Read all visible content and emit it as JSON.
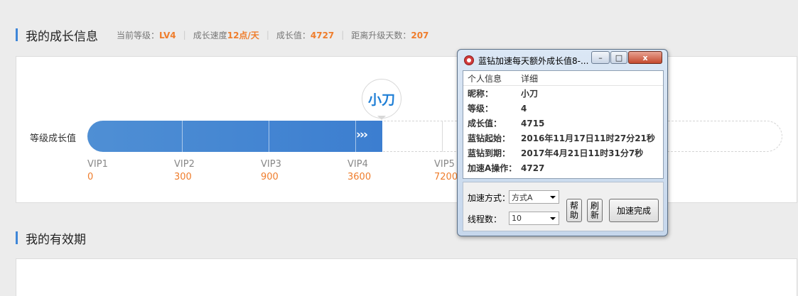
{
  "growth": {
    "title": "我的成长信息",
    "stats": [
      {
        "label": "当前等级：",
        "value": "LV4"
      },
      {
        "label": "成长速度",
        "value": "12点/天"
      },
      {
        "label": "成长值：",
        "value": "4727"
      },
      {
        "label": "距离升级天数：",
        "value": "207"
      }
    ],
    "track_label": "等级成长值",
    "avatar_text": "小刀",
    "progress_arrows": "›››",
    "levels": [
      {
        "name": "VIP1",
        "points": "0"
      },
      {
        "name": "VIP2",
        "points": "300"
      },
      {
        "name": "VIP3",
        "points": "900"
      },
      {
        "name": "VIP4",
        "points": "3600"
      },
      {
        "name": "VIP5",
        "points": "7200"
      }
    ]
  },
  "validity": {
    "title": "我的有效期"
  },
  "dialog": {
    "title": "蓝钻加速每天额外成长值8-...",
    "buttons": {
      "minimize": "–",
      "maximize": "□",
      "close": "x"
    },
    "list_headers": [
      "个人信息",
      "详细"
    ],
    "rows": [
      {
        "key": "昵称：",
        "value": "小刀"
      },
      {
        "key": "等级：",
        "value": "4"
      },
      {
        "key": "成长值：",
        "value": "4715"
      },
      {
        "key": "蓝钻起始：",
        "value": "2016年11月17日11时27分21秒"
      },
      {
        "key": "蓝钻到期：",
        "value": "2017年4月21日11时31分7秒"
      },
      {
        "key": "加速A操作：",
        "value": "4727"
      }
    ],
    "mode_label": "加速方式：",
    "mode_value": "方式A",
    "threads_label": "线程数：",
    "threads_value": "10",
    "help_label": "帮助",
    "refresh_label": "刷新",
    "finish_label": "加速完成"
  },
  "colors": {
    "accent": "#3e86d8",
    "orange": "#ef7d2c",
    "fill": "#4a8ad4"
  }
}
